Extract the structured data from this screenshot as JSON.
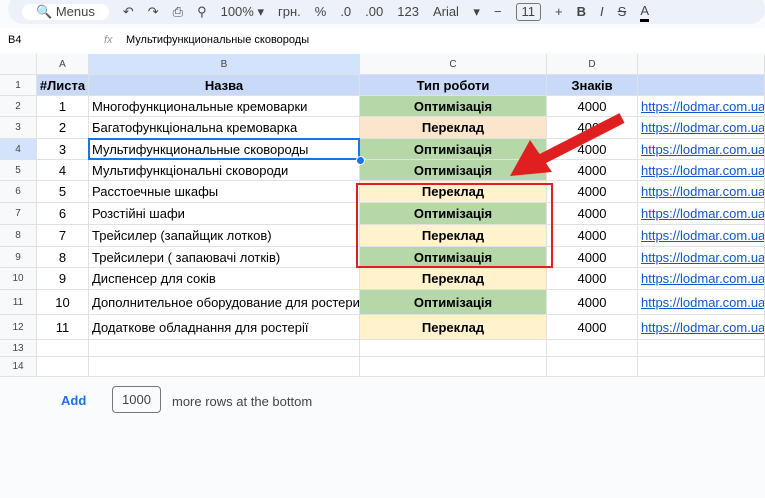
{
  "toolbar": {
    "menus": "Menus",
    "zoom": "100%",
    "currency": "грн.",
    "percent": "%",
    "dec_less": ".0",
    "dec_more": ".00",
    "format": "123",
    "font": "Arial",
    "font_size": "11"
  },
  "formula_bar": {
    "cell_ref": "B4",
    "fx": "fx",
    "value": "Мультифункциональные сковороды"
  },
  "columns": [
    "A",
    "B",
    "C",
    "D"
  ],
  "headers": [
    "#Листа",
    "Назва",
    "Тип роботи",
    "Знаків"
  ],
  "rows": [
    {
      "n": "2",
      "a": "1",
      "b": "Многофункциональные кремоварки",
      "c": "Оптимізація",
      "d": "4000",
      "e": "https://lodmar.com.ua",
      "color": "g"
    },
    {
      "n": "3",
      "a": "2",
      "b": "Багатофункціональна кремоварка",
      "c": "Переклад",
      "d": "4000",
      "e": "https://lodmar.com.ua",
      "color": "p"
    },
    {
      "n": "4",
      "a": "3",
      "b": "Мультифункциональные сковороды",
      "c": "Оптимізація",
      "d": "4000",
      "e": "https://lodmar.com.ua",
      "color": "g"
    },
    {
      "n": "5",
      "a": "4",
      "b": "Мультифункціональні сковороди",
      "c": "Оптимізація",
      "d": "4000",
      "e": "https://lodmar.com.ua",
      "color": "g"
    },
    {
      "n": "6",
      "a": "5",
      "b": "Расстоечные шкафы",
      "c": "Переклад",
      "d": "4000",
      "e": "https://lodmar.com.ua/te",
      "color": "y"
    },
    {
      "n": "7",
      "a": "6",
      "b": "Розстійні шафи",
      "c": "Оптимізація",
      "d": "4000",
      "e": "https://lodmar.com.ua",
      "color": "g"
    },
    {
      "n": "8",
      "a": "7",
      "b": "Трейсилер (запайщик лотков)",
      "c": "Переклад",
      "d": "4000",
      "e": "https://lodmar.com.ua",
      "color": "y"
    },
    {
      "n": "9",
      "a": "8",
      "b": "Трейсилери ( запаювачі лотків)",
      "c": "Оптимізація",
      "d": "4000",
      "e": "https://lodmar.com.ua",
      "color": "g"
    },
    {
      "n": "10",
      "a": "9",
      "b": "Диспенсер для соків",
      "c": "Переклад",
      "d": "4000",
      "e": "https://lodmar.com.ua",
      "color": "y"
    },
    {
      "n": "11",
      "a": "10",
      "b": "Дополнительное оборудование для ростерий",
      "c": "Оптимізація",
      "d": "4000",
      "e": "https://lodmar.com.ua",
      "color": "g"
    },
    {
      "n": "12",
      "a": "11",
      "b": "Додаткове обладнання для ростерії",
      "c": "Переклад",
      "d": "4000",
      "e": "https://lodmar.com.ua",
      "color": "y"
    }
  ],
  "empty_rows": [
    "13",
    "14"
  ],
  "footer": {
    "add": "Add",
    "count": "1000",
    "suffix": "more rows at the bottom"
  },
  "colors": {
    "green": "#b6d7a8",
    "yellow": "#fff2cc",
    "peach": "#fce5cd",
    "annotation": "#e02020"
  }
}
